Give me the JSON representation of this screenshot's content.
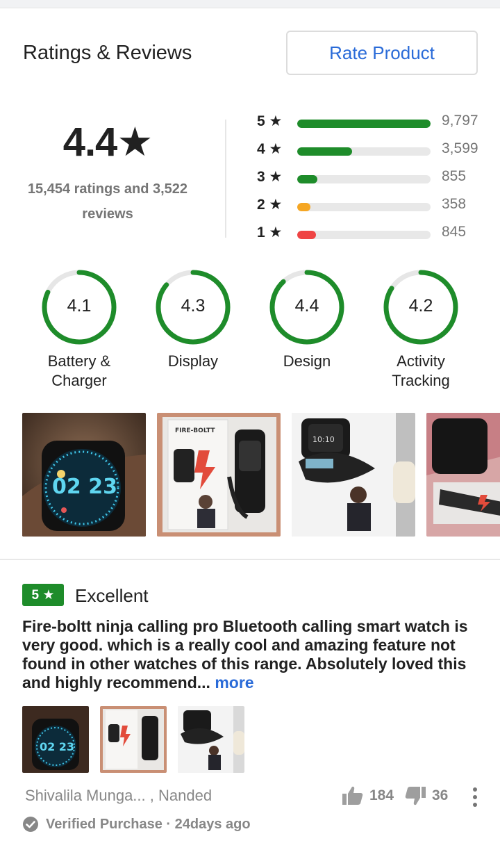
{
  "header": {
    "title": "Ratings & Reviews",
    "rate_button": "Rate Product"
  },
  "overall": {
    "score": "4.4★",
    "count_line1": "15,454 ratings and 3,522",
    "count_line2": "reviews"
  },
  "distribution": [
    {
      "label": "5 ★",
      "count": "9,797",
      "fraction": 1.0,
      "color": "#1e8c2a"
    },
    {
      "label": "4 ★",
      "count": "3,599",
      "fraction": 0.41,
      "color": "#1e8c2a"
    },
    {
      "label": "3 ★",
      "count": "855",
      "fraction": 0.15,
      "color": "#1e8c2a"
    },
    {
      "label": "2 ★",
      "count": "358",
      "fraction": 0.1,
      "color": "#f5a623"
    },
    {
      "label": "1 ★",
      "count": "845",
      "fraction": 0.14,
      "color": "#ef4444"
    }
  ],
  "aspects": [
    {
      "score": "4.1",
      "label_line1": "Battery &",
      "label_line2": "Charger",
      "fraction": 0.82
    },
    {
      "score": "4.3",
      "label_line1": "Display",
      "label_line2": "",
      "fraction": 0.86
    },
    {
      "score": "4.4",
      "label_line1": "Design",
      "label_line2": "",
      "fraction": 0.88
    },
    {
      "score": "4.2",
      "label_line1": "Activity",
      "label_line2": "Tracking",
      "fraction": 0.84
    }
  ],
  "photos": [
    {
      "icon": "smartwatch-on-wrist-photo",
      "time": "02 23"
    },
    {
      "icon": "watch-box-contents-photo",
      "brand": "FIRE-BOLTT"
    },
    {
      "icon": "watch-box-charger-photo",
      "time": "10:10"
    },
    {
      "icon": "watch-box-partial-photo"
    }
  ],
  "review": {
    "rating": "5 ★",
    "title": "Excellent",
    "body": "Fire-boltt ninja calling pro Bluetooth calling smart watch is very good. which is a really cool and amazing feature not found in other watches of this range. Absolutely loved this and highly recommend...",
    "more": "more",
    "author": "Shivalila Munga... , Nanded",
    "verified": "Verified Purchase · 24days ago",
    "likes": "184",
    "dislikes": "36"
  },
  "colors": {
    "accent_blue": "#2a6bd8",
    "rating_green": "#1e8c2a",
    "muted_text": "#878787"
  }
}
